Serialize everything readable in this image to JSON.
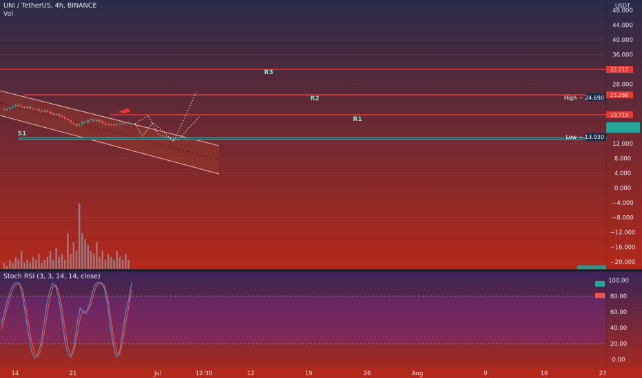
{
  "header": {
    "symbol_line": "UNI / TetherUS, 4h, BINANCE",
    "volume_label": "Vol",
    "currency": "USDT"
  },
  "colors": {
    "main_top": "#2a2a4a",
    "main_bottom": "#b5281a",
    "rsi_top": "#3b2458",
    "rsi_bottom": "#a52a22",
    "level_line": "#e53935",
    "support_line": "#4db6ac",
    "channel_fill": "#9c3a2a",
    "up_candle": "#26a69a",
    "down_candle": "#ef5350",
    "rsi_k": "#4f8fd8",
    "rsi_d": "#e8553a"
  },
  "chart_data": [
    {
      "type": "line",
      "name": "price_chart",
      "y_ticks": [
        "48.000",
        "44.000",
        "40.000",
        "36.000",
        "28.000",
        "12.000",
        "8.000",
        "4.000",
        "0.000",
        "−4.000",
        "−8.000",
        "−12.000",
        "−16.000",
        "−20.000"
      ],
      "x_ticks": [
        "14",
        "21",
        "Jul",
        "12:30",
        "12",
        "19",
        "26",
        "Aug",
        "9",
        "16",
        "23"
      ],
      "ylim": [
        -21,
        49
      ],
      "levels": [
        {
          "name": "R3",
          "value": 32.217,
          "label": "32.217"
        },
        {
          "name": "R2",
          "value": 25.268,
          "label": "25.268"
        },
        {
          "name": "R1",
          "value": 19.715,
          "label": "19.715"
        },
        {
          "name": "S1",
          "value": 13.93,
          "label": ""
        }
      ],
      "high_tag": "High  −  24.690",
      "low_tag": "Low  −  13.930",
      "close_values": [
        21.6,
        21.9,
        22.4,
        22.8,
        23.4,
        23.0,
        22.6,
        22.2,
        22.7,
        22.1,
        21.8,
        21.9,
        21.3,
        20.9,
        21.4,
        20.9,
        20.3,
        19.8,
        20.1,
        19.5,
        19.1,
        18.4,
        17.9,
        17.0,
        16.6,
        16.0,
        16.5,
        17.4,
        17.1,
        17.9,
        18.3,
        17.6,
        18.0,
        17.5,
        16.8,
        16.4,
        16.2,
        16.5,
        16.1,
        16.4,
        16.7,
        17.0,
        16.8,
        17.1
      ],
      "volume": [
        2,
        1,
        3,
        2,
        4,
        3,
        6,
        2,
        3,
        2,
        4,
        3,
        5,
        2,
        3,
        4,
        6,
        3,
        7,
        4,
        5,
        3,
        12,
        5,
        9,
        6,
        22,
        12,
        10,
        8,
        6,
        5,
        9,
        4,
        6,
        3,
        5,
        4,
        3,
        6,
        4,
        3,
        5,
        3
      ]
    },
    {
      "type": "line",
      "name": "Stoch RSI",
      "title": "Stoch RSI (3, 3, 14, 14, close)",
      "y_ticks": [
        "100.00",
        "80.00",
        "60.00",
        "40.00",
        "20.00",
        "0.00"
      ],
      "ylim": [
        -5,
        105
      ],
      "bands": [
        80,
        20
      ],
      "series": [
        {
          "values": [
            45,
            60,
            75,
            88,
            95,
            98,
            96,
            80,
            55,
            30,
            10,
            2,
            5,
            20,
            45,
            70,
            88,
            96,
            92,
            75,
            50,
            22,
            5,
            3,
            18,
            45,
            65,
            60,
            58,
            70,
            85,
            95,
            98,
            96,
            90,
            70,
            40,
            15,
            3,
            10,
            35,
            60,
            75,
            98
          ]
        },
        {
          "values": [
            38,
            52,
            66,
            80,
            90,
            95,
            96,
            88,
            68,
            45,
            22,
            8,
            4,
            12,
            30,
            55,
            77,
            91,
            94,
            85,
            65,
            38,
            15,
            5,
            10,
            30,
            52,
            62,
            60,
            64,
            76,
            89,
            96,
            97,
            93,
            80,
            55,
            28,
            10,
            6,
            22,
            46,
            66,
            88
          ]
        }
      ]
    }
  ]
}
